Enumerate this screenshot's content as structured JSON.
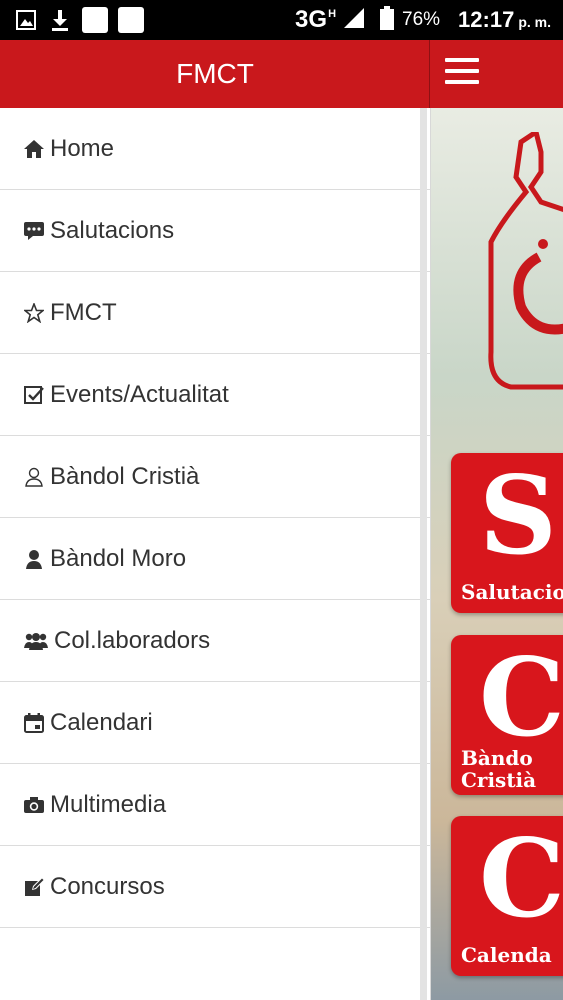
{
  "status_bar": {
    "network": "3G",
    "network_sup": "H",
    "battery": "76%",
    "time": "12:17",
    "ampm": "p. m."
  },
  "header": {
    "title": "FMCT"
  },
  "drawer": {
    "items": [
      {
        "label": "Home",
        "icon": "home-icon"
      },
      {
        "label": "Salutacions",
        "icon": "comment-icon"
      },
      {
        "label": "FMCT",
        "icon": "star-icon"
      },
      {
        "label": "Events/Actualitat",
        "icon": "checkbox-icon"
      },
      {
        "label": "Bàndol Cristià",
        "icon": "user-outline-icon"
      },
      {
        "label": "Bàndol Moro",
        "icon": "user-icon"
      },
      {
        "label": "Col.laboradors",
        "icon": "group-icon"
      },
      {
        "label": "Calendari",
        "icon": "calendar-icon"
      },
      {
        "label": "Multimedia",
        "icon": "camera-icon"
      },
      {
        "label": "Concursos",
        "icon": "edit-icon"
      }
    ]
  },
  "content": {
    "tiles": [
      {
        "letter": "S",
        "caption": "Salutacio"
      },
      {
        "letter": "C",
        "caption": "Bàndo\nCristià"
      },
      {
        "letter": "C",
        "caption": "Calenda"
      }
    ]
  },
  "colors": {
    "brand_red": "#c9181c",
    "tile_red": "#d8161c"
  }
}
